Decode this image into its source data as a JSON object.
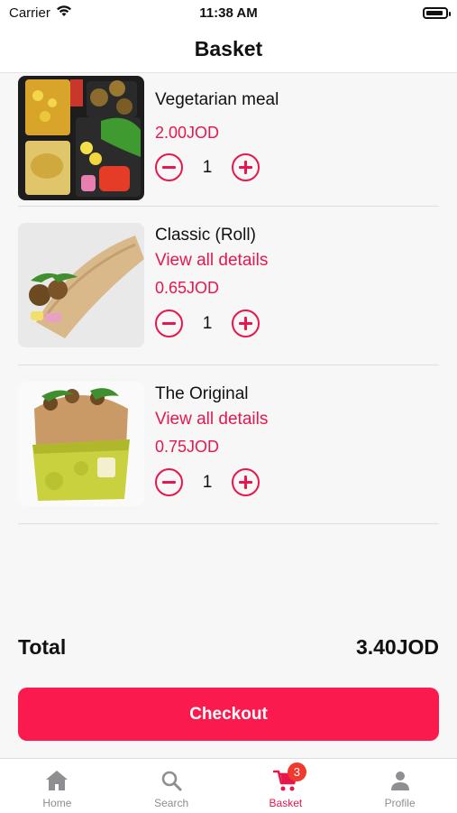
{
  "status_bar": {
    "carrier": "Carrier",
    "time": "11:38 AM"
  },
  "nav": {
    "title": "Basket"
  },
  "items": [
    {
      "name": "Vegetarian meal",
      "link": "",
      "price": "2.00JOD",
      "quantity": "1"
    },
    {
      "name": "Classic (Roll)",
      "link": "View all details",
      "price": "0.65JOD",
      "quantity": "1"
    },
    {
      "name": "The Original",
      "link": "View all details",
      "price": "0.75JOD",
      "quantity": "1"
    }
  ],
  "summary": {
    "total_label": "Total",
    "total_value": "3.40JOD"
  },
  "checkout_label": "Checkout",
  "tabs": [
    {
      "label": "Home",
      "icon": "home-icon"
    },
    {
      "label": "Search",
      "icon": "search-icon"
    },
    {
      "label": "Basket",
      "icon": "cart-icon",
      "badge": "3",
      "active": true
    },
    {
      "label": "Profile",
      "icon": "person-icon"
    }
  ],
  "colors": {
    "accent": "#e8174b",
    "checkout": "#fb1a4e",
    "badge": "#f03a2e"
  }
}
